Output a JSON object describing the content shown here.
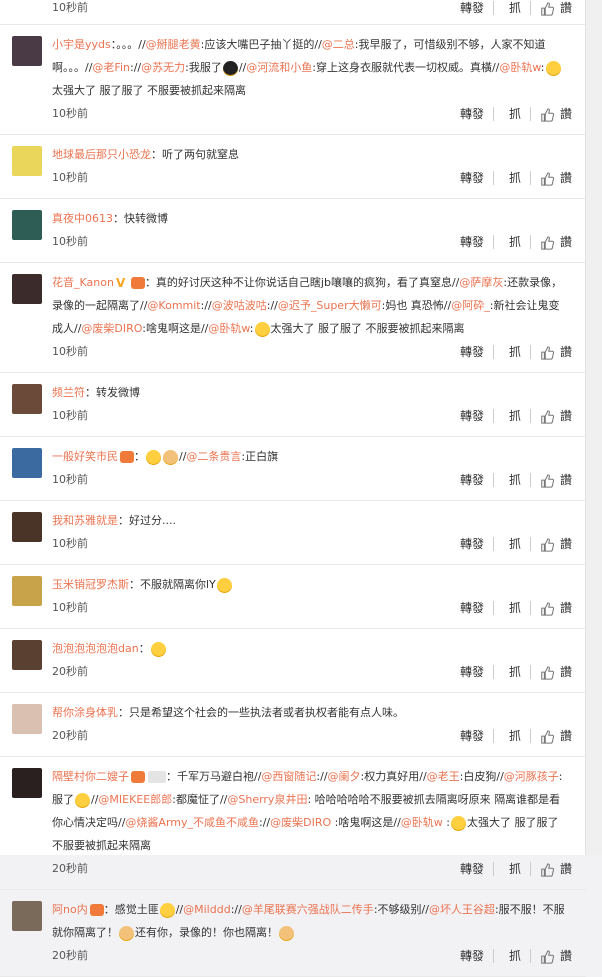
{
  "actions": {
    "forward": "轉發",
    "grab": "抓",
    "like_icon": "thumbs-up",
    "reply": "讚"
  },
  "comments": [
    {
      "user": "",
      "body": "",
      "time": "10秒前",
      "avatar": "#777777"
    },
    {
      "user": "小宇是yyds",
      "time": "10秒前",
      "avatar": "#4a3a45",
      "parts": [
        {
          "t": "text",
          "v": "：。。。//"
        },
        {
          "t": "mention",
          "v": "@掰腿老黄"
        },
        {
          "t": "text",
          "v": ":应该大嘴巴子抽丫挺的//"
        },
        {
          "t": "mention",
          "v": "@二总"
        },
        {
          "t": "text",
          "v": ":我早服了，可惜级别不够，人家不知道啊。。。//"
        },
        {
          "t": "mention",
          "v": "@老Fin"
        },
        {
          "t": "text",
          "v": "://"
        },
        {
          "t": "mention",
          "v": "@苏无力"
        },
        {
          "t": "text",
          "v": ":我服了"
        },
        {
          "t": "emo",
          "v": "black"
        },
        {
          "t": "text",
          "v": "//"
        },
        {
          "t": "mention",
          "v": "@河流和小鱼"
        },
        {
          "t": "text",
          "v": ":穿上这身衣服就代表一切权威。真橫//"
        },
        {
          "t": "mention",
          "v": "@卧轨w"
        },
        {
          "t": "text",
          "v": ":"
        },
        {
          "t": "emo",
          "v": "cry"
        },
        {
          "t": "text",
          "v": "太强大了 服了服了 不服要被抓起来隔离"
        }
      ]
    },
    {
      "user": "地球最后那只小恐龙",
      "time": "10秒前",
      "avatar": "#e9d65a",
      "parts": [
        {
          "t": "text",
          "v": "：听了两句就窒息"
        }
      ]
    },
    {
      "user": "真夜中0613",
      "time": "10秒前",
      "avatar": "#2d5d55",
      "parts": [
        {
          "t": "text",
          "v": "：快转微博"
        }
      ]
    },
    {
      "user": "花音_Kanon",
      "badges": [
        "v",
        "m"
      ],
      "time": "10秒前",
      "avatar": "#3b2b2b",
      "parts": [
        {
          "t": "text",
          "v": "：真的好讨厌这种不让你说话自己瞎jb嚷嚷的疯狗，看了真窒息//"
        },
        {
          "t": "mention",
          "v": "@萨摩灰"
        },
        {
          "t": "text",
          "v": ":还款录像，录像的一起隔离了//"
        },
        {
          "t": "mention",
          "v": "@Kommit"
        },
        {
          "t": "text",
          "v": "://"
        },
        {
          "t": "mention",
          "v": "@波咕波咕"
        },
        {
          "t": "text",
          "v": "://"
        },
        {
          "t": "mention",
          "v": "@迟予_Super大懒可"
        },
        {
          "t": "text",
          "v": ":妈也 真恐怖//"
        },
        {
          "t": "mention",
          "v": "@阿砕_"
        },
        {
          "t": "text",
          "v": ":新社会让鬼变成人//"
        },
        {
          "t": "mention",
          "v": "@废柴DIRO"
        },
        {
          "t": "text",
          "v": ":啥鬼啊这是//"
        },
        {
          "t": "mention",
          "v": "@卧轨w"
        },
        {
          "t": "text",
          "v": ":"
        },
        {
          "t": "emo",
          "v": "cry"
        },
        {
          "t": "text",
          "v": "太强大了 服了服了 不服要被抓起来隔离"
        }
      ]
    },
    {
      "user": "频兰符",
      "time": "10秒前",
      "avatar": "#6b4a3a",
      "parts": [
        {
          "t": "text",
          "v": "：转发微博"
        }
      ]
    },
    {
      "user": "一般好笑市民",
      "badges": [
        "m"
      ],
      "time": "10秒前",
      "avatar": "#3a6aa0",
      "parts": [
        {
          "t": "text",
          "v": "："
        },
        {
          "t": "emo",
          "v": "smirk"
        },
        {
          "t": "emo",
          "v": "thumb"
        },
        {
          "t": "text",
          "v": "//"
        },
        {
          "t": "mention",
          "v": "@二条贵言"
        },
        {
          "t": "text",
          "v": ":正白旗"
        }
      ]
    },
    {
      "user": "我和苏雅就是",
      "time": "10秒前",
      "avatar": "#4a3428",
      "parts": [
        {
          "t": "text",
          "v": "：好过分...."
        }
      ]
    },
    {
      "user": "玉米销冠罗杰斯",
      "time": "10秒前",
      "avatar": "#c8a34a",
      "parts": [
        {
          "t": "text",
          "v": "：不服就隔离你lY"
        },
        {
          "t": "emo",
          "v": "think"
        }
      ]
    },
    {
      "user": "泡泡泡泡泡泡dan",
      "time": "20秒前",
      "avatar": "#5a4030",
      "parts": [
        {
          "t": "text",
          "v": "："
        },
        {
          "t": "emo",
          "v": "smile"
        }
      ]
    },
    {
      "user": "帮你涂身体乳",
      "time": "20秒前",
      "avatar": "#d9c0b0",
      "parts": [
        {
          "t": "text",
          "v": "：只是希望这个社会的一些执法者或者执权者能有点人味。"
        }
      ]
    },
    {
      "user": "隔壁村你二嫂子",
      "badges": [
        "m",
        "s"
      ],
      "time": "20秒前",
      "avatar": "#2a2020",
      "parts": [
        {
          "t": "text",
          "v": "：千军万马避白袍//"
        },
        {
          "t": "mention",
          "v": "@西窗随记"
        },
        {
          "t": "text",
          "v": "://"
        },
        {
          "t": "mention",
          "v": "@阑夕"
        },
        {
          "t": "text",
          "v": ":权力真好用//"
        },
        {
          "t": "mention",
          "v": "@老王"
        },
        {
          "t": "text",
          "v": ":白皮狗//"
        },
        {
          "t": "mention",
          "v": "@河豚孩子"
        },
        {
          "t": "text",
          "v": ":服了"
        },
        {
          "t": "emo",
          "v": "smile"
        },
        {
          "t": "text",
          "v": "//"
        },
        {
          "t": "mention",
          "v": "@MIEKEE郎郎"
        },
        {
          "t": "text",
          "v": ":都魔怔了//"
        },
        {
          "t": "mention",
          "v": "@Sherry泉井田"
        },
        {
          "t": "text",
          "v": ": 哈哈哈哈哈不服要被抓去隔离呀原来 隔离谁都是看你心情决定吗//"
        },
        {
          "t": "mention",
          "v": "@烧酱Army_不咸鱼不咸鱼"
        },
        {
          "t": "text",
          "v": "://"
        },
        {
          "t": "mention",
          "v": "@废柴DIRO"
        },
        {
          "t": "text",
          "v": " :啥鬼啊这是//"
        },
        {
          "t": "mention",
          "v": "@卧轨w"
        },
        {
          "t": "text",
          "v": " :"
        },
        {
          "t": "emo",
          "v": "cry"
        },
        {
          "t": "text",
          "v": "太强大了 服了服了 不服要被抓起来隔离"
        }
      ]
    },
    {
      "user": "阿no内",
      "badges": [
        "m"
      ],
      "time": "20秒前",
      "avatar": "#7a6a5a",
      "parts": [
        {
          "t": "text",
          "v": "：感觉土匪"
        },
        {
          "t": "emo",
          "v": "grin"
        },
        {
          "t": "text",
          "v": "//"
        },
        {
          "t": "mention",
          "v": "@Milddd"
        },
        {
          "t": "text",
          "v": "://"
        },
        {
          "t": "mention",
          "v": "@羊尾联赛六强战队二传手"
        },
        {
          "t": "text",
          "v": ":不够级别//"
        },
        {
          "t": "mention",
          "v": "@坏人王谷超"
        },
        {
          "t": "text",
          "v": ":服不服！不服就你隔离了！"
        },
        {
          "t": "emo",
          "v": "fist"
        },
        {
          "t": "text",
          "v": "还有你，录像的！你也隔离！"
        },
        {
          "t": "emo",
          "v": "fist"
        }
      ]
    }
  ]
}
